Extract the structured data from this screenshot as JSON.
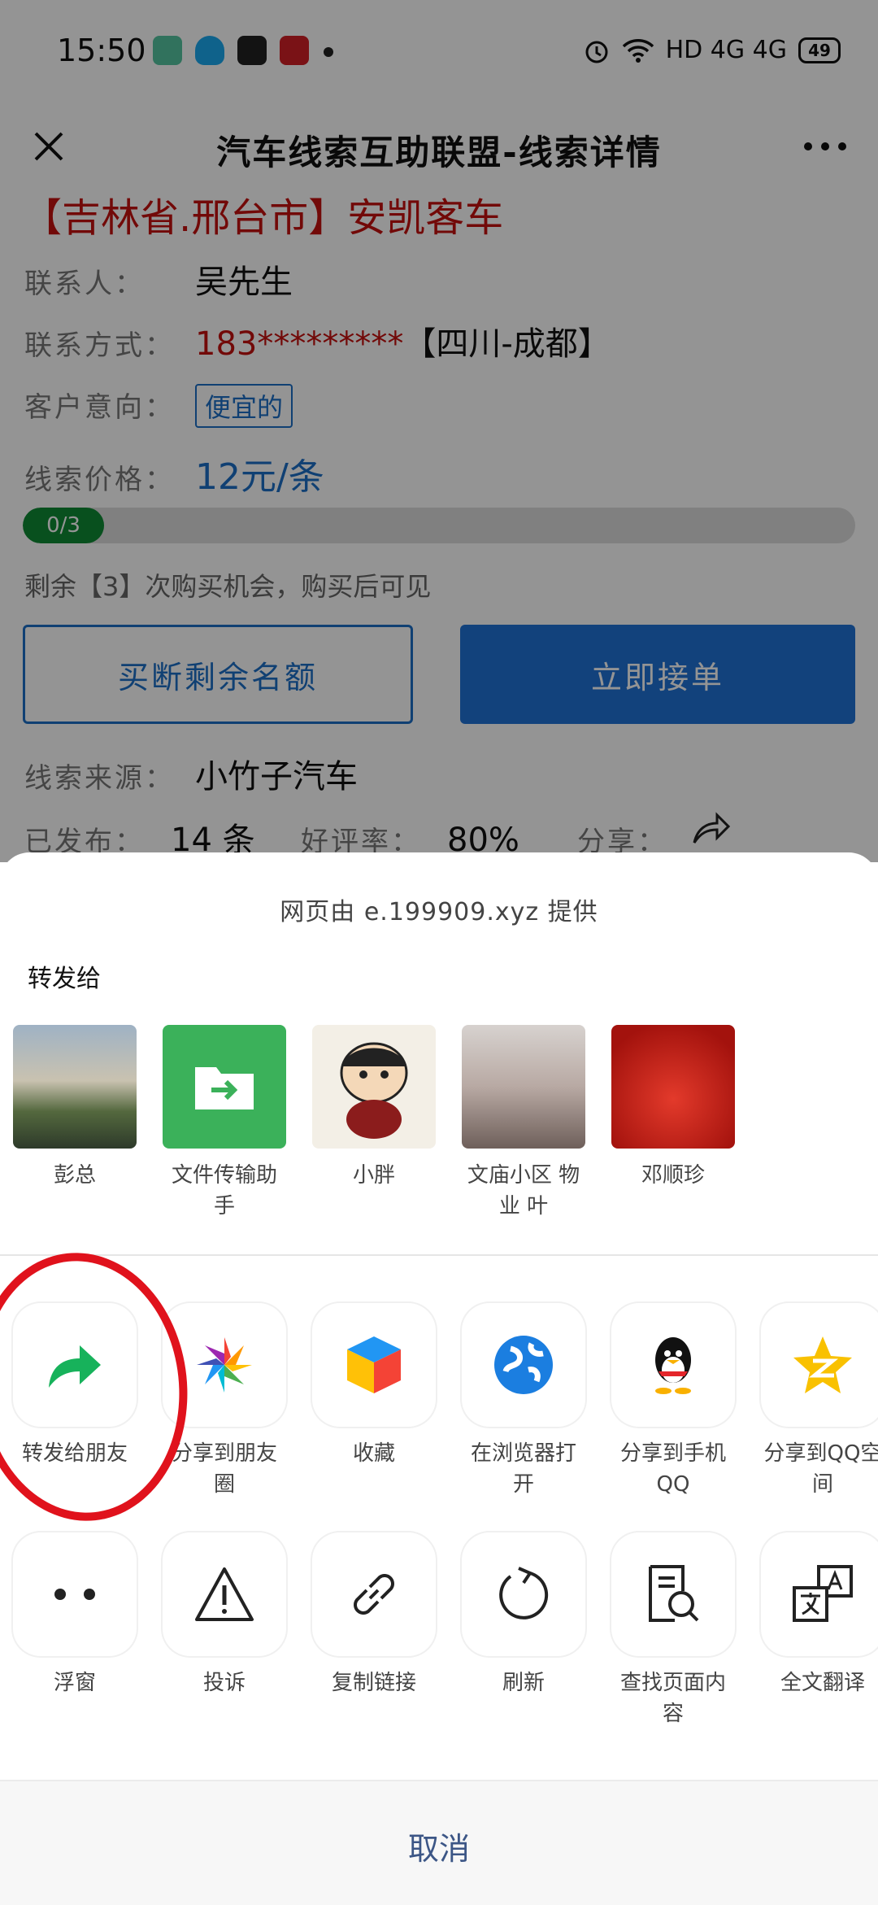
{
  "status_bar": {
    "time": "15:50",
    "network": "HD 4G 4G",
    "battery": "49"
  },
  "header": {
    "title": "汽车线索互助联盟-线索详情"
  },
  "lead": {
    "title": "【吉林省.邢台市】安凯客车",
    "contact_label": "联系人：",
    "contact_name": "吴先生",
    "phone_label": "联系方式：",
    "phone_value": "183*********",
    "phone_location": "【四川-成都】",
    "intent_label": "客户意向：",
    "intent_tag": "便宜的",
    "price_label": "线索价格：",
    "price_value": "12元/条",
    "progress_text": "0/3",
    "progress_fraction": 0.0,
    "remaining_text": "剩余【3】次购买机会，购买后可见",
    "buyout_button": "买断剩余名额",
    "accept_button": "立即接单",
    "source_label": "线索来源：",
    "source_value": "小竹子汽车",
    "published_label": "已发布：",
    "published_value": "14 条",
    "rating_label": "好评率：",
    "rating_value": "80%",
    "share_label": "分享："
  },
  "share_sheet": {
    "provider": "网页由 e.199909.xyz 提供",
    "forward_to": "转发给",
    "contacts": [
      {
        "name": "彭总",
        "avatar": "photo-avatar"
      },
      {
        "name": "文件传输助手",
        "avatar": "file-transfer-icon"
      },
      {
        "name": "小胖",
        "avatar": "cartoon-avatar"
      },
      {
        "name": "文庙小区 物业 叶",
        "avatar": "photo-avatar"
      },
      {
        "name": "邓顺珍",
        "avatar": "festive-avatar"
      }
    ],
    "actions_row1": [
      {
        "label": "转发给朋友",
        "icon": "forward-arrow-icon"
      },
      {
        "label": "分享到朋友圈",
        "icon": "moments-icon"
      },
      {
        "label": "收藏",
        "icon": "favorites-cube-icon"
      },
      {
        "label": "在浏览器打开",
        "icon": "browser-globe-icon"
      },
      {
        "label": "分享到手机QQ",
        "icon": "qq-penguin-icon"
      },
      {
        "label": "分享到QQ空间",
        "icon": "qzone-star-icon"
      }
    ],
    "actions_row2": [
      {
        "label": "浮窗",
        "icon": "float-window-icon"
      },
      {
        "label": "投诉",
        "icon": "warning-icon"
      },
      {
        "label": "复制链接",
        "icon": "link-icon"
      },
      {
        "label": "刷新",
        "icon": "refresh-icon"
      },
      {
        "label": "查找页面内容",
        "icon": "search-doc-icon"
      },
      {
        "label": "全文翻译",
        "icon": "translate-icon"
      }
    ],
    "cancel": "取消"
  },
  "colors": {
    "accent_blue": "#1f72d6",
    "red": "#c5100f",
    "green": "#0e8a35",
    "annotation_red": "#e0121c"
  }
}
